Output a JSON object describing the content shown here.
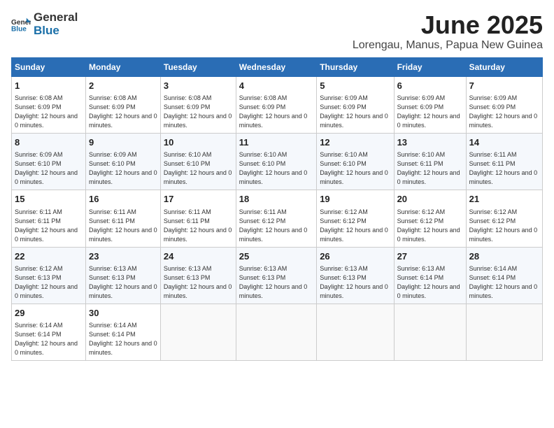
{
  "logo": {
    "general": "General",
    "blue": "Blue"
  },
  "title": "June 2025",
  "location": "Lorengau, Manus, Papua New Guinea",
  "headers": [
    "Sunday",
    "Monday",
    "Tuesday",
    "Wednesday",
    "Thursday",
    "Friday",
    "Saturday"
  ],
  "weeks": [
    [
      {
        "day": "1",
        "sunrise": "6:08 AM",
        "sunset": "6:09 PM",
        "daylight": "12 hours and 0 minutes."
      },
      {
        "day": "2",
        "sunrise": "6:08 AM",
        "sunset": "6:09 PM",
        "daylight": "12 hours and 0 minutes."
      },
      {
        "day": "3",
        "sunrise": "6:08 AM",
        "sunset": "6:09 PM",
        "daylight": "12 hours and 0 minutes."
      },
      {
        "day": "4",
        "sunrise": "6:08 AM",
        "sunset": "6:09 PM",
        "daylight": "12 hours and 0 minutes."
      },
      {
        "day": "5",
        "sunrise": "6:09 AM",
        "sunset": "6:09 PM",
        "daylight": "12 hours and 0 minutes."
      },
      {
        "day": "6",
        "sunrise": "6:09 AM",
        "sunset": "6:09 PM",
        "daylight": "12 hours and 0 minutes."
      },
      {
        "day": "7",
        "sunrise": "6:09 AM",
        "sunset": "6:09 PM",
        "daylight": "12 hours and 0 minutes."
      }
    ],
    [
      {
        "day": "8",
        "sunrise": "6:09 AM",
        "sunset": "6:10 PM",
        "daylight": "12 hours and 0 minutes."
      },
      {
        "day": "9",
        "sunrise": "6:09 AM",
        "sunset": "6:10 PM",
        "daylight": "12 hours and 0 minutes."
      },
      {
        "day": "10",
        "sunrise": "6:10 AM",
        "sunset": "6:10 PM",
        "daylight": "12 hours and 0 minutes."
      },
      {
        "day": "11",
        "sunrise": "6:10 AM",
        "sunset": "6:10 PM",
        "daylight": "12 hours and 0 minutes."
      },
      {
        "day": "12",
        "sunrise": "6:10 AM",
        "sunset": "6:10 PM",
        "daylight": "12 hours and 0 minutes."
      },
      {
        "day": "13",
        "sunrise": "6:10 AM",
        "sunset": "6:11 PM",
        "daylight": "12 hours and 0 minutes."
      },
      {
        "day": "14",
        "sunrise": "6:11 AM",
        "sunset": "6:11 PM",
        "daylight": "12 hours and 0 minutes."
      }
    ],
    [
      {
        "day": "15",
        "sunrise": "6:11 AM",
        "sunset": "6:11 PM",
        "daylight": "12 hours and 0 minutes."
      },
      {
        "day": "16",
        "sunrise": "6:11 AM",
        "sunset": "6:11 PM",
        "daylight": "12 hours and 0 minutes."
      },
      {
        "day": "17",
        "sunrise": "6:11 AM",
        "sunset": "6:11 PM",
        "daylight": "12 hours and 0 minutes."
      },
      {
        "day": "18",
        "sunrise": "6:11 AM",
        "sunset": "6:12 PM",
        "daylight": "12 hours and 0 minutes."
      },
      {
        "day": "19",
        "sunrise": "6:12 AM",
        "sunset": "6:12 PM",
        "daylight": "12 hours and 0 minutes."
      },
      {
        "day": "20",
        "sunrise": "6:12 AM",
        "sunset": "6:12 PM",
        "daylight": "12 hours and 0 minutes."
      },
      {
        "day": "21",
        "sunrise": "6:12 AM",
        "sunset": "6:12 PM",
        "daylight": "12 hours and 0 minutes."
      }
    ],
    [
      {
        "day": "22",
        "sunrise": "6:12 AM",
        "sunset": "6:13 PM",
        "daylight": "12 hours and 0 minutes."
      },
      {
        "day": "23",
        "sunrise": "6:13 AM",
        "sunset": "6:13 PM",
        "daylight": "12 hours and 0 minutes."
      },
      {
        "day": "24",
        "sunrise": "6:13 AM",
        "sunset": "6:13 PM",
        "daylight": "12 hours and 0 minutes."
      },
      {
        "day": "25",
        "sunrise": "6:13 AM",
        "sunset": "6:13 PM",
        "daylight": "12 hours and 0 minutes."
      },
      {
        "day": "26",
        "sunrise": "6:13 AM",
        "sunset": "6:13 PM",
        "daylight": "12 hours and 0 minutes."
      },
      {
        "day": "27",
        "sunrise": "6:13 AM",
        "sunset": "6:14 PM",
        "daylight": "12 hours and 0 minutes."
      },
      {
        "day": "28",
        "sunrise": "6:14 AM",
        "sunset": "6:14 PM",
        "daylight": "12 hours and 0 minutes."
      }
    ],
    [
      {
        "day": "29",
        "sunrise": "6:14 AM",
        "sunset": "6:14 PM",
        "daylight": "12 hours and 0 minutes."
      },
      {
        "day": "30",
        "sunrise": "6:14 AM",
        "sunset": "6:14 PM",
        "daylight": "12 hours and 0 minutes."
      },
      null,
      null,
      null,
      null,
      null
    ]
  ],
  "labels": {
    "sunrise": "Sunrise:",
    "sunset": "Sunset:",
    "daylight": "Daylight:"
  }
}
